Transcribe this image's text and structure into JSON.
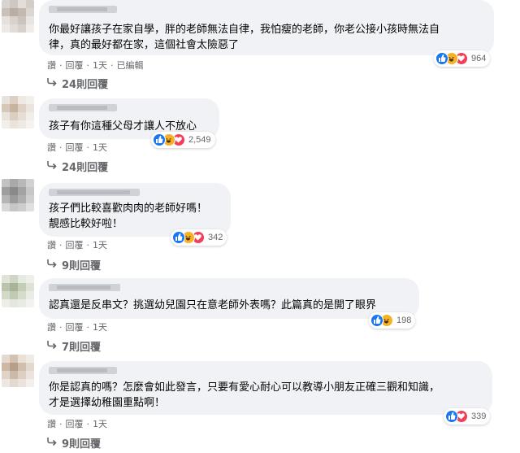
{
  "colors": {
    "bubble": "#f0f2f5",
    "meta_text": "#65676b",
    "like": "#1877f2",
    "haha": "#f7b125",
    "love": "#f33e58"
  },
  "actions": {
    "reply": "回覆",
    "like": "讚",
    "sep": "·"
  },
  "comments": [
    {
      "lines": [
        "你最好讓孩子在家自學，胖的老師無法自律，我怕瘦的老師，你老公接小孩時無法自",
        "律，真的最好都在家，這個社會太險惡了"
      ],
      "reactions": [
        "like-icon",
        "haha-icon",
        "love-icon"
      ],
      "reaction_count": "964",
      "time": "1天",
      "edited": "已編輯",
      "replies": "24則回覆"
    },
    {
      "lines": [
        "孩子有你這種父母才讓人不放心"
      ],
      "reactions": [
        "like-icon",
        "haha-icon",
        "love-icon"
      ],
      "reaction_count": "2,549",
      "time": "1天",
      "replies": "24則回覆"
    },
    {
      "lines": [
        "孩子們比較喜歡肉肉的老師好嗎！",
        "靚感比較好啦！"
      ],
      "reactions": [
        "like-icon",
        "haha-icon",
        "love-icon"
      ],
      "reaction_count": "342",
      "time": "1天",
      "replies": "9則回覆"
    },
    {
      "lines": [
        "認真還是反串文？挑選幼兒園只在意老師外表嗎？此篇真的是開了眼界"
      ],
      "reactions": [
        "like-icon",
        "haha-icon"
      ],
      "reaction_count": "198",
      "time": "1天",
      "replies": "7則回覆"
    },
    {
      "lines": [
        "你是認真的嗎？怎麼會如此發言，只要有愛心耐心可以教導小朋友正確三觀和知識，",
        "才是選擇幼稚園重點啊！"
      ],
      "reactions": [
        "like-icon",
        "love-icon"
      ],
      "reaction_count": "339",
      "time": "1天",
      "replies": "9則回覆"
    }
  ]
}
